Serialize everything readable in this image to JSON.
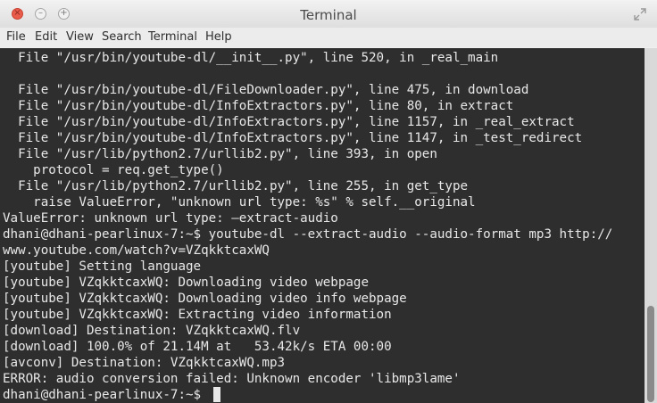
{
  "window": {
    "title": "Terminal"
  },
  "menu": [
    "File",
    "Edit",
    "View",
    "Search",
    "Terminal",
    "Help"
  ],
  "terminal": {
    "lines": [
      "  File \"/usr/bin/youtube-dl/__init__.py\", line 520, in _real_main",
      "",
      "  File \"/usr/bin/youtube-dl/FileDownloader.py\", line 475, in download",
      "  File \"/usr/bin/youtube-dl/InfoExtractors.py\", line 80, in extract",
      "  File \"/usr/bin/youtube-dl/InfoExtractors.py\", line 1157, in _real_extract",
      "  File \"/usr/bin/youtube-dl/InfoExtractors.py\", line 1147, in _test_redirect",
      "  File \"/usr/lib/python2.7/urllib2.py\", line 393, in open",
      "    protocol = req.get_type()",
      "  File \"/usr/lib/python2.7/urllib2.py\", line 255, in get_type",
      "    raise ValueError, \"unknown url type: %s\" % self.__original",
      "ValueError: unknown url type: —extract-audio",
      "dhani@dhani-pearlinux-7:~$ youtube-dl --extract-audio --audio-format mp3 http://",
      "www.youtube.com/watch?v=VZqkktcaxWQ",
      "[youtube] Setting language",
      "[youtube] VZqkktcaxWQ: Downloading video webpage",
      "[youtube] VZqkktcaxWQ: Downloading video info webpage",
      "[youtube] VZqkktcaxWQ: Extracting video information",
      "[download] Destination: VZqkktcaxWQ.flv",
      "[download] 100.0% of 21.14M at   53.42k/s ETA 00:00",
      "[avconv] Destination: VZqkktcaxWQ.mp3",
      "ERROR: audio conversion failed: Unknown encoder 'libmp3lame'",
      "dhani@dhani-pearlinux-7:~$ "
    ]
  },
  "colors": {
    "terminal_bg": "#2e2e2e",
    "terminal_fg": "#e8e8e8",
    "close_button": "#e95b4b"
  },
  "icons": {
    "close": "close-icon",
    "minimize": "minimize-icon",
    "maximize": "maximize-icon",
    "resize": "resize-icon"
  }
}
